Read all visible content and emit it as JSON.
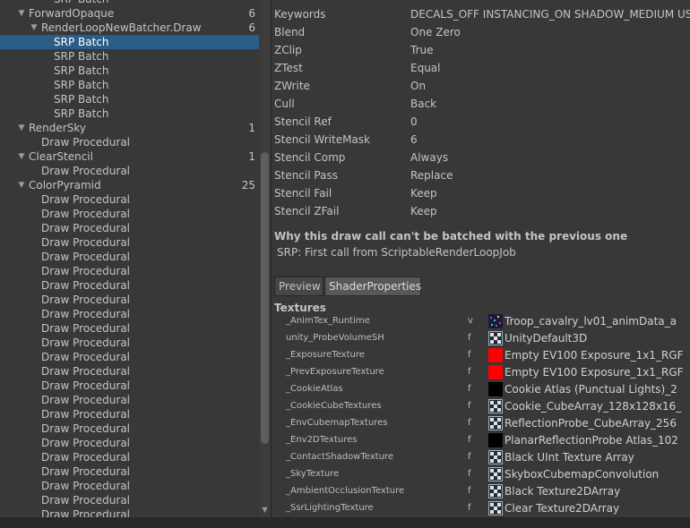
{
  "tree": {
    "rows": [
      {
        "label": "SRP Batch",
        "count": "",
        "indent": 3,
        "arrow": "",
        "selected": false,
        "partial": true
      },
      {
        "label": "ForwardOpaque",
        "count": "6",
        "indent": 1,
        "arrow": "▼",
        "selected": false
      },
      {
        "label": "RenderLoopNewBatcher.Draw",
        "count": "6",
        "indent": 2,
        "arrow": "▼",
        "selected": false
      },
      {
        "label": "SRP Batch",
        "count": "",
        "indent": 3,
        "arrow": "",
        "selected": true
      },
      {
        "label": "SRP Batch",
        "count": "",
        "indent": 3,
        "arrow": "",
        "selected": false
      },
      {
        "label": "SRP Batch",
        "count": "",
        "indent": 3,
        "arrow": "",
        "selected": false
      },
      {
        "label": "SRP Batch",
        "count": "",
        "indent": 3,
        "arrow": "",
        "selected": false
      },
      {
        "label": "SRP Batch",
        "count": "",
        "indent": 3,
        "arrow": "",
        "selected": false
      },
      {
        "label": "SRP Batch",
        "count": "",
        "indent": 3,
        "arrow": "",
        "selected": false
      },
      {
        "label": "RenderSky",
        "count": "1",
        "indent": 1,
        "arrow": "▼",
        "selected": false
      },
      {
        "label": "Draw Procedural",
        "count": "",
        "indent": 2,
        "arrow": "",
        "selected": false
      },
      {
        "label": "ClearStencil",
        "count": "1",
        "indent": 1,
        "arrow": "▼",
        "selected": false
      },
      {
        "label": "Draw Procedural",
        "count": "",
        "indent": 2,
        "arrow": "",
        "selected": false
      },
      {
        "label": "ColorPyramid",
        "count": "25",
        "indent": 1,
        "arrow": "▼",
        "selected": false
      },
      {
        "label": "Draw Procedural",
        "count": "",
        "indent": 2,
        "arrow": "",
        "selected": false
      },
      {
        "label": "Draw Procedural",
        "count": "",
        "indent": 2,
        "arrow": "",
        "selected": false
      },
      {
        "label": "Draw Procedural",
        "count": "",
        "indent": 2,
        "arrow": "",
        "selected": false
      },
      {
        "label": "Draw Procedural",
        "count": "",
        "indent": 2,
        "arrow": "",
        "selected": false
      },
      {
        "label": "Draw Procedural",
        "count": "",
        "indent": 2,
        "arrow": "",
        "selected": false
      },
      {
        "label": "Draw Procedural",
        "count": "",
        "indent": 2,
        "arrow": "",
        "selected": false
      },
      {
        "label": "Draw Procedural",
        "count": "",
        "indent": 2,
        "arrow": "",
        "selected": false
      },
      {
        "label": "Draw Procedural",
        "count": "",
        "indent": 2,
        "arrow": "",
        "selected": false
      },
      {
        "label": "Draw Procedural",
        "count": "",
        "indent": 2,
        "arrow": "",
        "selected": false
      },
      {
        "label": "Draw Procedural",
        "count": "",
        "indent": 2,
        "arrow": "",
        "selected": false
      },
      {
        "label": "Draw Procedural",
        "count": "",
        "indent": 2,
        "arrow": "",
        "selected": false
      },
      {
        "label": "Draw Procedural",
        "count": "",
        "indent": 2,
        "arrow": "",
        "selected": false
      },
      {
        "label": "Draw Procedural",
        "count": "",
        "indent": 2,
        "arrow": "",
        "selected": false
      },
      {
        "label": "Draw Procedural",
        "count": "",
        "indent": 2,
        "arrow": "",
        "selected": false
      },
      {
        "label": "Draw Procedural",
        "count": "",
        "indent": 2,
        "arrow": "",
        "selected": false
      },
      {
        "label": "Draw Procedural",
        "count": "",
        "indent": 2,
        "arrow": "",
        "selected": false
      },
      {
        "label": "Draw Procedural",
        "count": "",
        "indent": 2,
        "arrow": "",
        "selected": false
      },
      {
        "label": "Draw Procedural",
        "count": "",
        "indent": 2,
        "arrow": "",
        "selected": false
      },
      {
        "label": "Draw Procedural",
        "count": "",
        "indent": 2,
        "arrow": "",
        "selected": false
      },
      {
        "label": "Draw Procedural",
        "count": "",
        "indent": 2,
        "arrow": "",
        "selected": false
      },
      {
        "label": "Draw Procedural",
        "count": "",
        "indent": 2,
        "arrow": "",
        "selected": false
      },
      {
        "label": "Draw Procedural",
        "count": "",
        "indent": 2,
        "arrow": "",
        "selected": false
      },
      {
        "label": "Draw Procedural",
        "count": "",
        "indent": 2,
        "arrow": "",
        "selected": false
      },
      {
        "label": "Draw Procedural",
        "count": "",
        "indent": 2,
        "arrow": "",
        "selected": false
      }
    ]
  },
  "properties": [
    {
      "key": "Keywords",
      "value": "DECALS_OFF INSTANCING_ON SHADOW_MEDIUM USE"
    },
    {
      "key": "Blend",
      "value": "One Zero"
    },
    {
      "key": "ZClip",
      "value": "True"
    },
    {
      "key": "ZTest",
      "value": "Equal"
    },
    {
      "key": "ZWrite",
      "value": "On"
    },
    {
      "key": "Cull",
      "value": "Back"
    },
    {
      "key": "Stencil Ref",
      "value": "0"
    },
    {
      "key": "Stencil WriteMask",
      "value": "6"
    },
    {
      "key": "Stencil Comp",
      "value": "Always"
    },
    {
      "key": "Stencil Pass",
      "value": "Replace"
    },
    {
      "key": "Stencil Fail",
      "value": "Keep"
    },
    {
      "key": "Stencil ZFail",
      "value": "Keep"
    }
  ],
  "batch_reason": {
    "title": "Why this draw call can't be batched with the previous one",
    "text": "SRP: First call from ScriptableRenderLoopJob"
  },
  "tabs": {
    "preview": "Preview",
    "shader_properties": "ShaderProperties"
  },
  "textures": {
    "header": "Textures",
    "items": [
      {
        "name": "_AnimTex_Runtime",
        "flag": "v",
        "thumb": "troop",
        "value": "Troop_cavalry_lv01_animData_a"
      },
      {
        "name": "unity_ProbeVolumeSH",
        "flag": "f",
        "thumb": "checker",
        "value": "UnityDefault3D"
      },
      {
        "name": "_ExposureTexture",
        "flag": "f",
        "thumb": "red",
        "value": "Empty EV100 Exposure_1x1_RGF"
      },
      {
        "name": "_PrevExposureTexture",
        "flag": "f",
        "thumb": "red",
        "value": "Empty EV100 Exposure_1x1_RGF"
      },
      {
        "name": "_CookieAtlas",
        "flag": "f",
        "thumb": "black",
        "value": "Cookie Atlas (Punctual Lights)_2"
      },
      {
        "name": "_CookieCubeTextures",
        "flag": "f",
        "thumb": "checker",
        "value": "Cookie_CubeArray_128x128x16_"
      },
      {
        "name": "_EnvCubemapTextures",
        "flag": "f",
        "thumb": "checker",
        "value": "ReflectionProbe_CubeArray_256"
      },
      {
        "name": "_Env2DTextures",
        "flag": "f",
        "thumb": "black",
        "value": "PlanarReflectionProbe Atlas_102"
      },
      {
        "name": "_ContactShadowTexture",
        "flag": "f",
        "thumb": "checker",
        "value": "Black UInt Texture Array"
      },
      {
        "name": "_SkyTexture",
        "flag": "f",
        "thumb": "checker",
        "value": "SkyboxCubemapConvolution"
      },
      {
        "name": "_AmbientOcclusionTexture",
        "flag": "f",
        "thumb": "checker",
        "value": "Black Texture2DArray"
      },
      {
        "name": "_SsrLightingTexture",
        "flag": "f",
        "thumb": "checker",
        "value": "Clear Texture2DArray"
      }
    ]
  },
  "colors": {
    "selection": "#2c5d87",
    "background": "#383838",
    "red_thumb": "#ff0000"
  }
}
